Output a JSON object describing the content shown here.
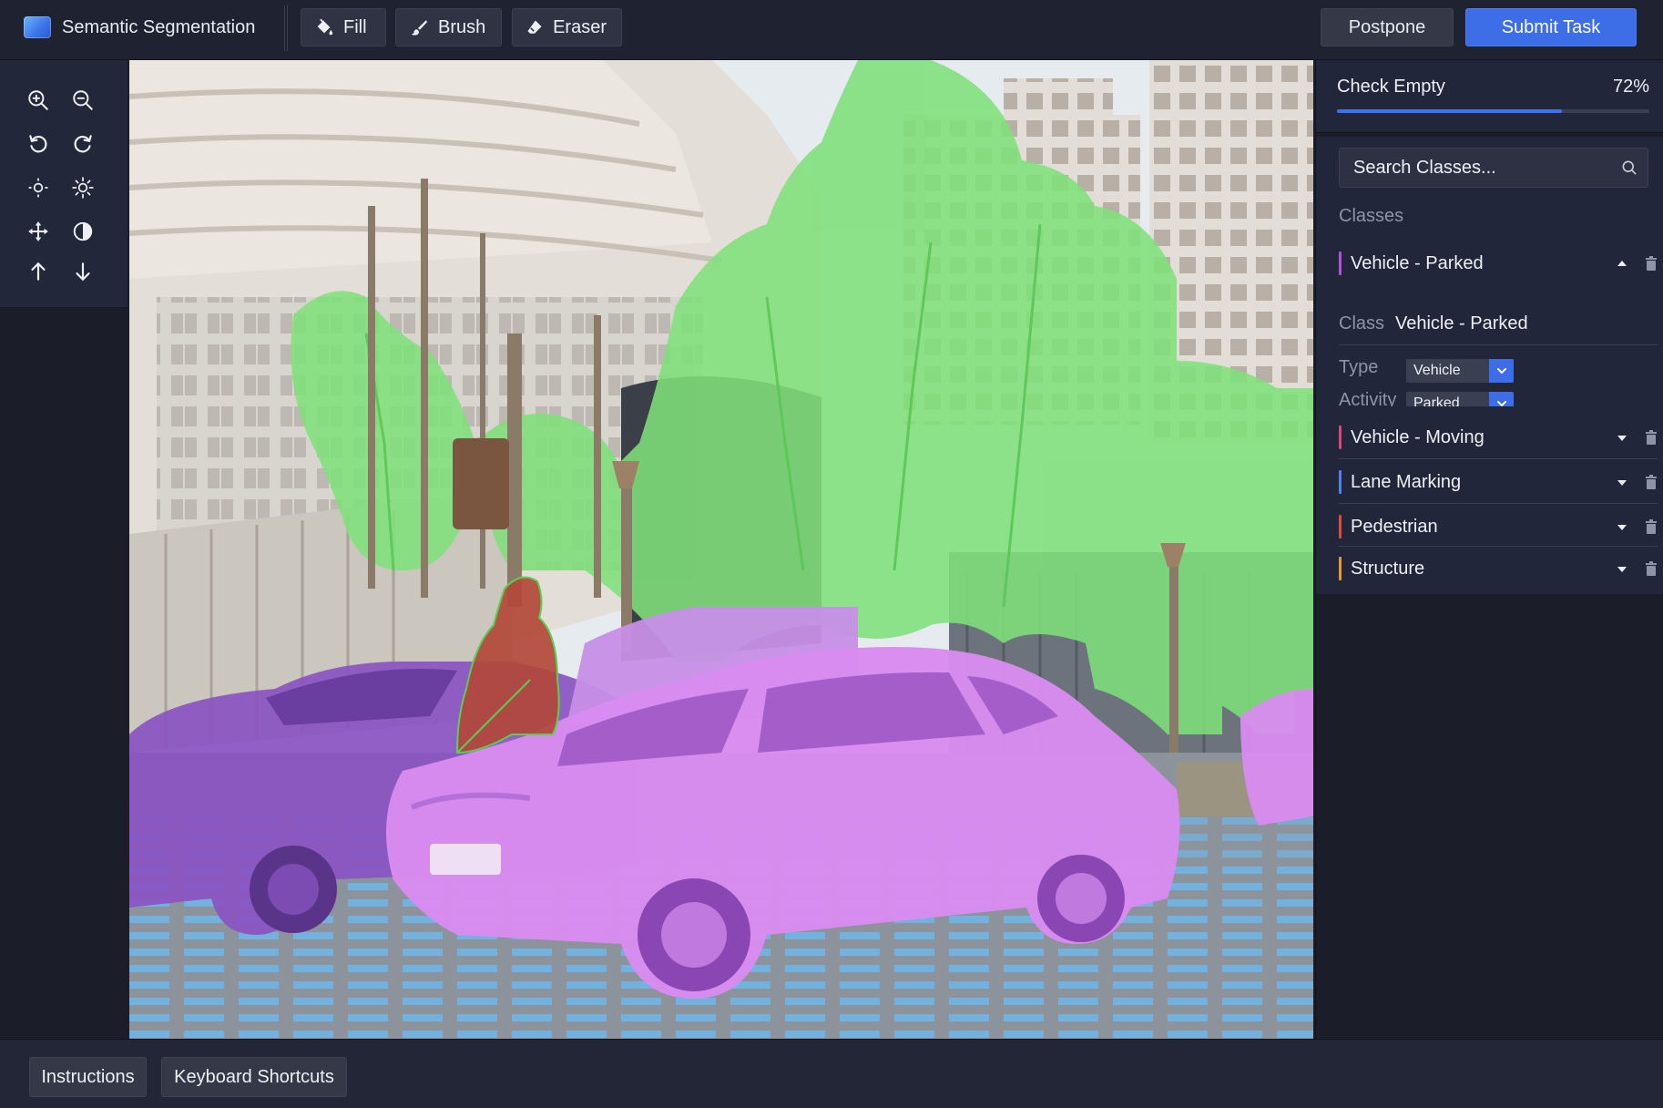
{
  "app": {
    "title": "Semantic Segmentation",
    "logo_icon": "app-logo-icon"
  },
  "toolbar": {
    "fill_label": "Fill",
    "brush_label": "Brush",
    "eraser_label": "Eraser",
    "postpone_label": "Postpone",
    "submit_label": "Submit Task",
    "submit_color": "#3d6ee8"
  },
  "toolbox": {
    "tools": [
      "zoom-in-icon",
      "zoom-out-icon",
      "rotate-left-icon",
      "rotate-right-icon",
      "brightness-down-icon",
      "brightness-up-icon",
      "move-icon",
      "contrast-icon",
      "arrow-up-icon",
      "arrow-down-icon"
    ]
  },
  "progress": {
    "label": "Check Empty",
    "value": "72%",
    "fraction": 0.72,
    "color": "#3f72ea"
  },
  "classes_panel": {
    "search_placeholder": "Search Classes...",
    "heading": "Classes",
    "items": [
      {
        "label": "Vehicle - Parked",
        "color": "#b44fe0",
        "expanded": true
      },
      {
        "label": "Vehicle - Moving",
        "color": "#d8467f",
        "expanded": false
      },
      {
        "label": "Lane Marking",
        "color": "#4b84e6",
        "expanded": false
      },
      {
        "label": "Pedestrian",
        "color": "#e04a3c",
        "expanded": false
      },
      {
        "label": "Structure",
        "color": "#e69a2e",
        "expanded": false
      }
    ],
    "detail": {
      "class_label": "Class",
      "class_value": "Vehicle - Parked",
      "type_label": "Type",
      "type_value": "Vehicle",
      "activity_label": "Activity",
      "activity_value": "Parked"
    }
  },
  "bottom": {
    "instructions_label": "Instructions",
    "shortcuts_label": "Keyboard Shortcuts"
  },
  "overlay_colors": {
    "vegetation": "#7fe07a",
    "vehicle_parked": "#d98bf0",
    "vehicle_dark": "#8a52c2",
    "lane_marking": "#6fb8ec",
    "pedestrian": "#b2483a"
  }
}
